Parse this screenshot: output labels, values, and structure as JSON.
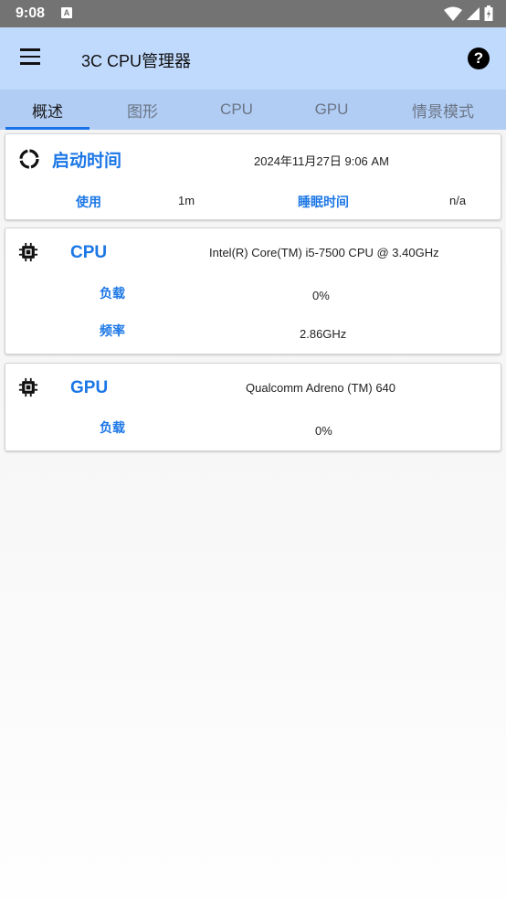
{
  "status_bar": {
    "time": "9:08",
    "notification_icon": "A",
    "icons": [
      "wifi-icon",
      "signal-icon",
      "battery-charging-icon"
    ]
  },
  "appbar": {
    "title": "3C CPU管理器",
    "menu_icon": "hamburger-menu-icon",
    "help_icon": "?"
  },
  "tabs": [
    {
      "label": "概述",
      "active": true
    },
    {
      "label": "图形",
      "active": false
    },
    {
      "label": "CPU",
      "active": false
    },
    {
      "label": "GPU",
      "active": false
    },
    {
      "label": "情景模式",
      "active": false
    }
  ],
  "boot_card": {
    "title": "启动时间",
    "datetime": "2024年11月27日 9:06 AM",
    "uptime_label": "使用",
    "uptime_value": "1m",
    "sleep_label": "睡眠时间",
    "sleep_value": "n/a"
  },
  "cpu_card": {
    "title": "CPU",
    "model": "Intel(R) Core(TM) i5-7500 CPU @ 3.40GHz",
    "load_label": "负载",
    "load_value": "0%",
    "freq_label": "频率",
    "freq_value": "2.86GHz"
  },
  "gpu_card": {
    "title": "GPU",
    "model": "Qualcomm Adreno (TM) 640",
    "load_label": "负载",
    "load_value": "0%"
  },
  "colors": {
    "accent": "#1c77e6",
    "appbar": "#c0dafd",
    "tabbar": "#b1cdf4",
    "status_bar": "#737373"
  }
}
